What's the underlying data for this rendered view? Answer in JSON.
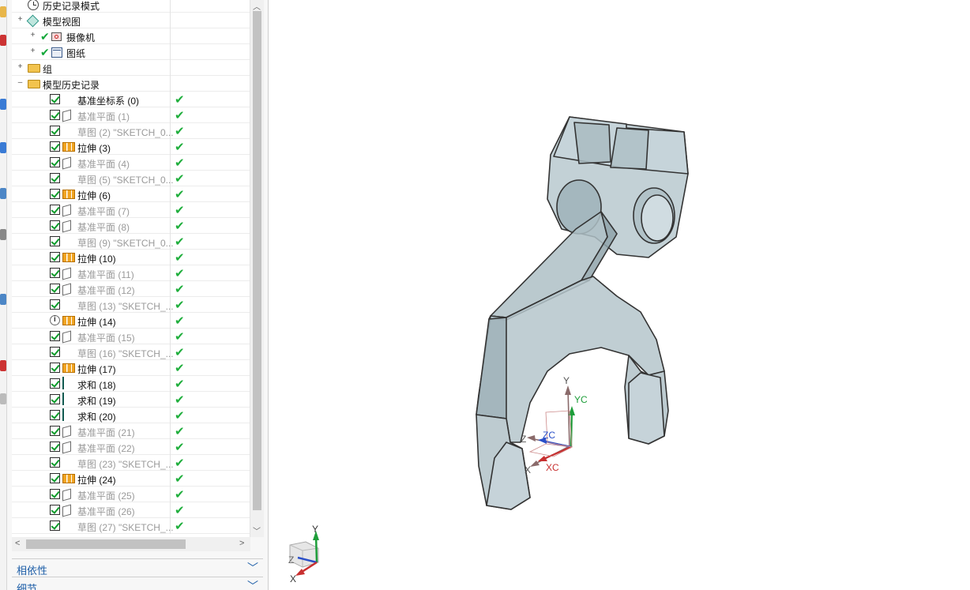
{
  "navigator": {
    "rows": [
      {
        "label": "历史记录模式",
        "dim": false
      },
      {
        "label": "模型视图",
        "dim": false
      },
      {
        "label": "摄像机",
        "dim": false
      },
      {
        "label": "图纸",
        "dim": false
      },
      {
        "label": "组",
        "dim": false
      },
      {
        "label": "模型历史记录",
        "dim": false
      },
      {
        "label": "基准坐标系 (0)",
        "dim": false
      },
      {
        "label": "基准平面 (1)",
        "dim": true
      },
      {
        "label": "草图 (2) \"SKETCH_0...",
        "dim": true
      },
      {
        "label": "拉伸 (3)",
        "dim": false
      },
      {
        "label": "基准平面 (4)",
        "dim": true
      },
      {
        "label": "草图 (5) \"SKETCH_0...",
        "dim": true
      },
      {
        "label": "拉伸 (6)",
        "dim": false
      },
      {
        "label": "基准平面 (7)",
        "dim": true
      },
      {
        "label": "基准平面 (8)",
        "dim": true
      },
      {
        "label": "草图 (9) \"SKETCH_0...",
        "dim": true
      },
      {
        "label": "拉伸 (10)",
        "dim": false
      },
      {
        "label": "基准平面 (11)",
        "dim": true
      },
      {
        "label": "基准平面 (12)",
        "dim": true
      },
      {
        "label": "草图 (13) \"SKETCH_...",
        "dim": true
      },
      {
        "label": "拉伸 (14)",
        "dim": false
      },
      {
        "label": "基准平面 (15)",
        "dim": true
      },
      {
        "label": "草图 (16) \"SKETCH_...",
        "dim": true
      },
      {
        "label": "拉伸 (17)",
        "dim": false
      },
      {
        "label": "求和 (18)",
        "dim": false
      },
      {
        "label": "求和 (19)",
        "dim": false
      },
      {
        "label": "求和 (20)",
        "dim": false
      },
      {
        "label": "基准平面 (21)",
        "dim": true
      },
      {
        "label": "基准平面 (22)",
        "dim": true
      },
      {
        "label": "草图 (23) \"SKETCH_...",
        "dim": true
      },
      {
        "label": "拉伸 (24)",
        "dim": false
      },
      {
        "label": "基准平面 (25)",
        "dim": true
      },
      {
        "label": "基准平面 (26)",
        "dim": true
      },
      {
        "label": "草图 (27) \"SKETCH_...",
        "dim": true
      }
    ]
  },
  "sections": {
    "dependencies": "相依性",
    "details": "细节"
  },
  "viewport": {
    "csys_labels": {
      "y": "Y",
      "yc": "YC",
      "z": "Z",
      "zc": "ZC",
      "x": "X",
      "xc": "XC"
    },
    "triad_labels": {
      "y": "Y",
      "z": "Z",
      "x": "X"
    }
  },
  "colors": {
    "accent": "#1f5fa8",
    "check_green": "#1fae3c",
    "model_fill": "#b9c9cf",
    "model_edge": "#333333"
  }
}
